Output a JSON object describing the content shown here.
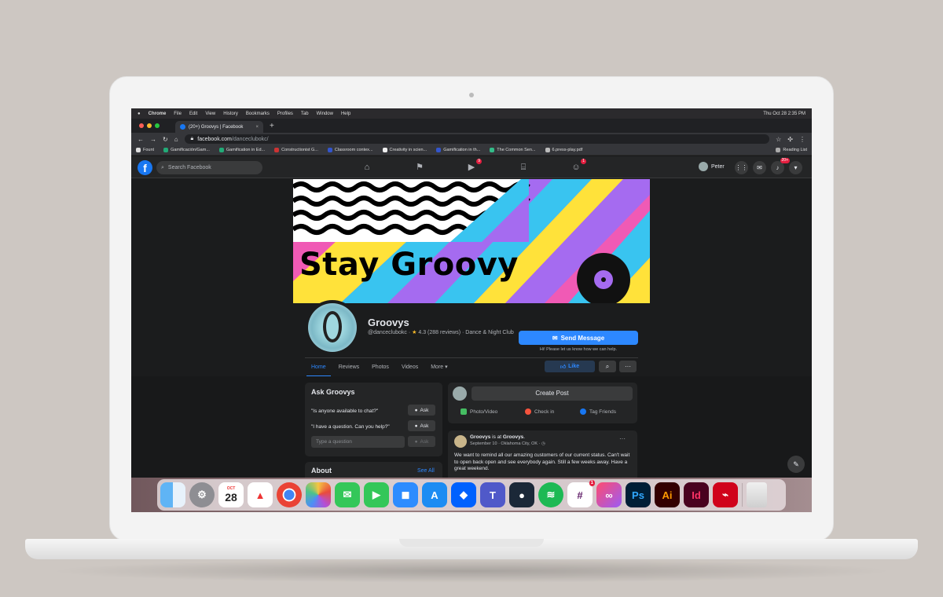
{
  "mac_menu": {
    "apple": "",
    "app": "Chrome",
    "items": [
      "File",
      "Edit",
      "View",
      "History",
      "Bookmarks",
      "Profiles",
      "Tab",
      "Window",
      "Help"
    ],
    "clock": "Thu Oct 28  2:35 PM"
  },
  "browser": {
    "tab_title": "(20+) Groovys | Facebook",
    "tab_close": "×",
    "new_tab": "+",
    "url_host": "facebook.com",
    "url_path": "/danceclubokc/",
    "bookmarks": [
      "Fount",
      "Gamificación/Gam...",
      "Gamification in Ed...",
      "Constructionist G...",
      "Classroom contex...",
      "Creativity in scien...",
      "Gamification in th...",
      "The Common Sen...",
      "6.press-play.pdf"
    ],
    "reading_list": "Reading List"
  },
  "fb_nav": {
    "logo": "f",
    "search_placeholder": "Search Facebook",
    "watch_badge": "9",
    "groups_badge": "1",
    "profile_name": "Peter",
    "notif_badge": "20+"
  },
  "page": {
    "cover_text": "Stay Groovy",
    "name": "Groovys",
    "handle": "@danceclubokc · ",
    "star": "★",
    "rating": "4.3 (288 reviews) · Dance & Night Club",
    "send_message": "Send Message",
    "send_sub": "Hi! Please let us know how we can help.",
    "tabs": [
      "Home",
      "Reviews",
      "Photos",
      "Videos",
      "More ▾"
    ],
    "like": "Like",
    "search_icon": "⌕",
    "more_icon": "···"
  },
  "ask": {
    "title": "Ask Groovys",
    "q1": "\"Is anyone available to chat?\"",
    "q2": "\"I have a question. Can you help?\"",
    "ask_label": "Ask",
    "input_placeholder": "Type a question"
  },
  "about": {
    "title": "About",
    "see_all": "See All"
  },
  "create_post": {
    "button": "Create Post",
    "photo": "Photo/Video",
    "checkin": "Check in",
    "tag": "Tag Friends"
  },
  "post": {
    "author": "Groovys",
    "at": " is at ",
    "place": "Groovys",
    "place_suffix": ".",
    "sub": "September 10 · Oklahoma City, OK · ◷",
    "text": "We want to remind all our amazing customers of our current status. Can't wait to open back open and see everybody again.  Still a few weeks away.  Have a great weekend.",
    "menu": "···"
  },
  "dock": {
    "calendar_month": "OCT",
    "calendar_day": "28",
    "slack_badge": "1",
    "ps": "Ps",
    "ai": "Ai",
    "id": "Id"
  },
  "colors": {
    "fb_blue": "#1877f2",
    "fb_dark": "#18191a",
    "fb_card": "#242526",
    "link": "#2d88ff"
  }
}
